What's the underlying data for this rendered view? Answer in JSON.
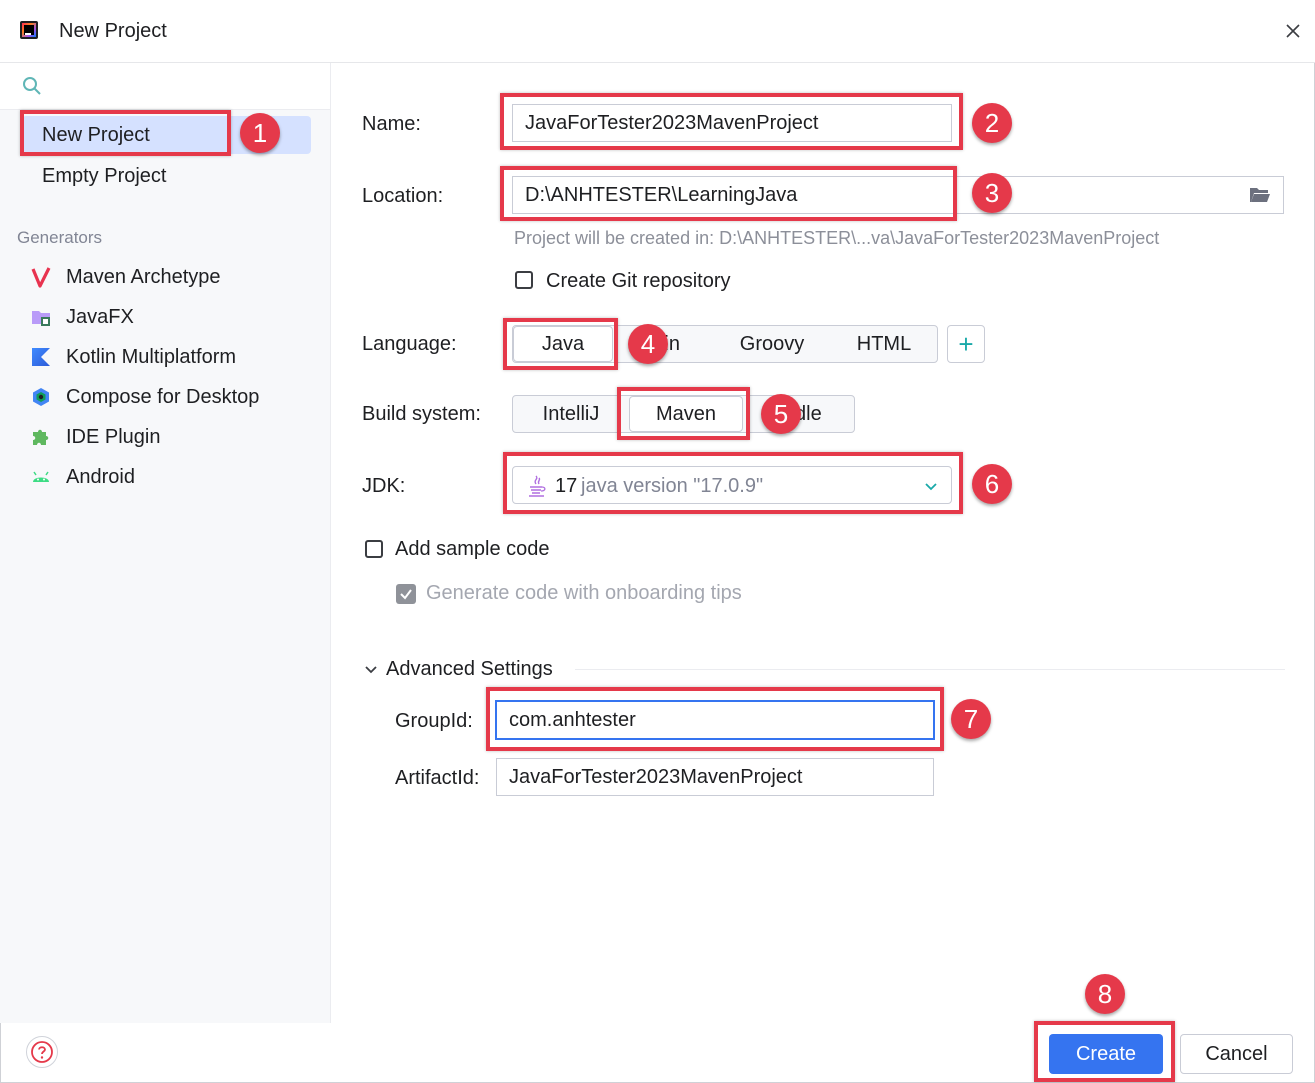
{
  "window": {
    "title": "New Project"
  },
  "sidebar": {
    "search": {
      "value": "",
      "placeholder": ""
    },
    "items": [
      {
        "label": "New Project",
        "selected": true
      },
      {
        "label": "Empty Project",
        "selected": false
      }
    ],
    "generators_label": "Generators",
    "generators": [
      {
        "label": "Maven Archetype",
        "icon": "maven-icon"
      },
      {
        "label": "JavaFX",
        "icon": "folder-icon"
      },
      {
        "label": "Kotlin Multiplatform",
        "icon": "kotlin-icon"
      },
      {
        "label": "Compose for Desktop",
        "icon": "compose-icon"
      },
      {
        "label": "IDE Plugin",
        "icon": "puzzle-icon"
      },
      {
        "label": "Android",
        "icon": "android-icon"
      }
    ]
  },
  "form": {
    "name": {
      "label": "Name:",
      "value": "JavaForTester2023MavenProject"
    },
    "location": {
      "label": "Location:",
      "value": "D:\\ANHTESTER\\LearningJava",
      "hint": "Project will be created in: D:\\ANHTESTER\\...va\\JavaForTester2023MavenProject"
    },
    "git": {
      "label": "Create Git repository",
      "checked": false
    },
    "language": {
      "label": "Language:",
      "options": [
        "Java",
        "Kotlin",
        "Groovy",
        "HTML"
      ],
      "visible_partial": "lin",
      "selected": "Java"
    },
    "build_system": {
      "label": "Build system:",
      "options": [
        "IntelliJ",
        "Maven",
        "Gradle"
      ],
      "visible_partial": "dle",
      "selected": "Maven"
    },
    "jdk": {
      "label": "JDK:",
      "version": "17",
      "detail": "java version \"17.0.9\""
    },
    "sample_code": {
      "label": "Add sample code",
      "checked": false
    },
    "onboarding": {
      "label": "Generate code with onboarding tips",
      "checked": true,
      "disabled": true
    },
    "advanced": {
      "label": "Advanced Settings",
      "group_id": {
        "label": "GroupId:",
        "value": "com.anhtester"
      },
      "artifact_id": {
        "label": "ArtifactId:",
        "value": "JavaForTester2023MavenProject"
      }
    }
  },
  "buttons": {
    "create": "Create",
    "cancel": "Cancel"
  },
  "annotations": [
    "1",
    "2",
    "3",
    "4",
    "5",
    "6",
    "7",
    "8"
  ],
  "colors": {
    "accent": "#3574f0",
    "annotation": "#e5394a",
    "selection": "#d5e1ff"
  }
}
